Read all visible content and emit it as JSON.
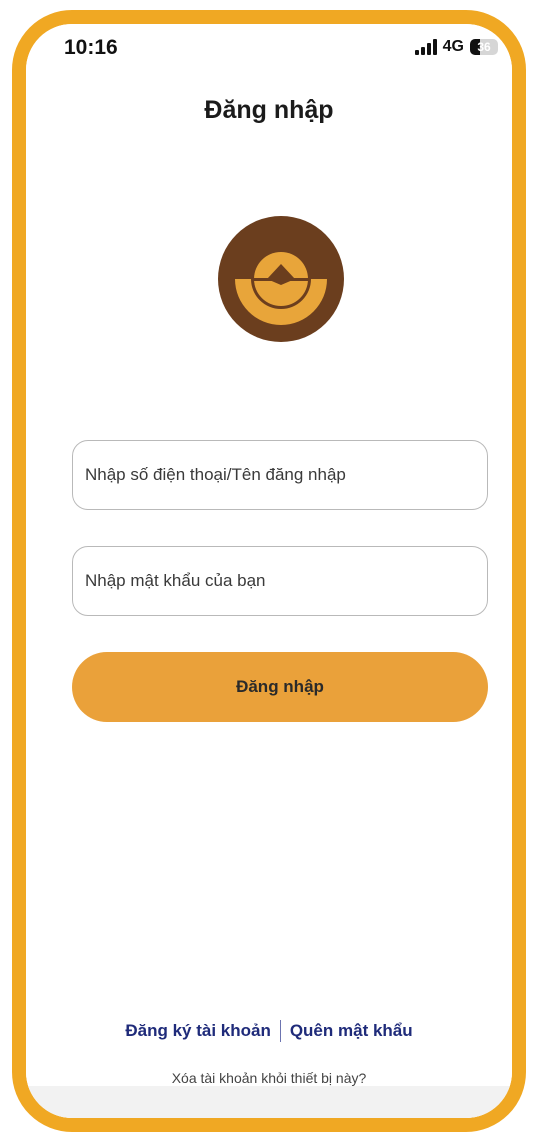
{
  "status_bar": {
    "time": "10:16",
    "network": "4G",
    "battery_level": "36",
    "battery_fraction": 0.36
  },
  "header": {
    "title": "Đăng nhập"
  },
  "logo": {
    "icon": "brand-logo-icon",
    "outer_color": "#6B3E1E",
    "inner_color": "#E8A53A"
  },
  "form": {
    "phone_placeholder": "Nhập số điện thoại/Tên đăng nhập",
    "phone_value": "",
    "password_placeholder": "Nhập mật khẩu của bạn",
    "password_value": "",
    "login_label": "Đăng nhập"
  },
  "footer": {
    "register_label": "Đăng ký tài khoản",
    "forgot_label": "Quên mật khẩu",
    "remove_account_label": "Xóa tài khoản khỏi thiết bị này?"
  },
  "colors": {
    "frame": "#F0A823",
    "button": "#EAA13A",
    "link": "#1f2b7a"
  }
}
